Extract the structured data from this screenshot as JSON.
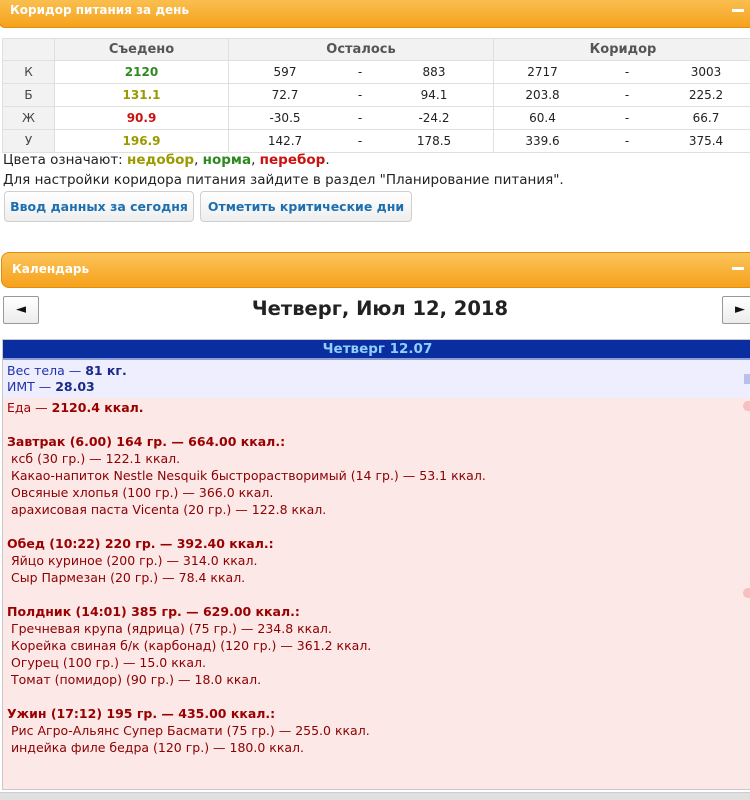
{
  "panels": {
    "nutrition_title": "Коридор питания за день",
    "calendar_title": "Календарь"
  },
  "table": {
    "headers": [
      "Съедено",
      "Осталось",
      "Коридор"
    ],
    "rows": [
      {
        "label": "К",
        "eaten": "2120",
        "status": "norm",
        "left_min": "597",
        "left_max": "883",
        "corr_min": "2717",
        "corr_max": "3003"
      },
      {
        "label": "Б",
        "eaten": "131.1",
        "status": "under",
        "left_min": "72.7",
        "left_max": "94.1",
        "corr_min": "203.8",
        "corr_max": "225.2"
      },
      {
        "label": "Ж",
        "eaten": "90.9",
        "status": "over",
        "left_min": "-30.5",
        "left_max": "-24.2",
        "corr_min": "60.4",
        "corr_max": "66.7"
      },
      {
        "label": "У",
        "eaten": "196.9",
        "status": "under",
        "left_min": "142.7",
        "left_max": "178.5",
        "corr_min": "339.6",
        "corr_max": "375.4"
      }
    ],
    "dash": "-"
  },
  "legend": {
    "prefix": "Цвета означают: ",
    "under": "недобор",
    "sep1": ", ",
    "norm": "норма",
    "sep2": ", ",
    "over": "перебор",
    "suffix": ".",
    "hint": "Для настройки коридора питания зайдите в раздел \"Планирование питания\"."
  },
  "buttons": {
    "today": "Ввод данных за сегодня",
    "critical": "Отметить критические дни"
  },
  "calendar": {
    "prev": "◄",
    "next": "►",
    "date_title": "Четверг, Июл 12, 2018",
    "day_header": "Четверг 12.07"
  },
  "body": {
    "weight_label": "Вес тела — ",
    "weight_value": "81 кг.",
    "bmi_label": "ИМТ — ",
    "bmi_value": "28.03"
  },
  "food": {
    "total_label": "Еда — ",
    "total_value": "2120.4 ккал.",
    "meals": [
      {
        "title": "Завтрак (6.00) 164 гр. — 664.00 ккал.:",
        "items": [
          "ксб (30 гр.) — 122.1 ккал.",
          "Какао-напиток Nestle Nesquik быстрорастворимый (14 гр.) — 53.1 ккал.",
          "Овсяные хлопья (100 гр.) — 366.0 ккал.",
          "арахисовая паста Vicenta (20 гр.) — 122.8 ккал."
        ]
      },
      {
        "title": "Обед (10:22) 220 гр. — 392.40 ккал.:",
        "items": [
          "Яйцо куриное (200 гр.) — 314.0 ккал.",
          "Сыр Пармезан (20 гр.) — 78.4 ккал."
        ]
      },
      {
        "title": "Полдник (14:01) 385 гр. — 629.00 ккал.:",
        "items": [
          "Гречневая крупа (ядрица) (75 гр.) — 234.8 ккал.",
          "Корейка свиная б/к (карбонад) (120 гр.) — 361.2 ккал.",
          "Огурец (100 гр.) — 15.0 ккал.",
          "Томат (помидор) (90 гр.) — 18.0 ккал."
        ]
      },
      {
        "title": "Ужин (17:12) 195 гр. — 435.00 ккал.:",
        "items": [
          "Рис Агро-Альянс Супер Басмати (75 гр.) — 255.0 ккал.",
          "индейка филе бедра (120 гр.) — 180.0 ккал."
        ]
      }
    ]
  }
}
